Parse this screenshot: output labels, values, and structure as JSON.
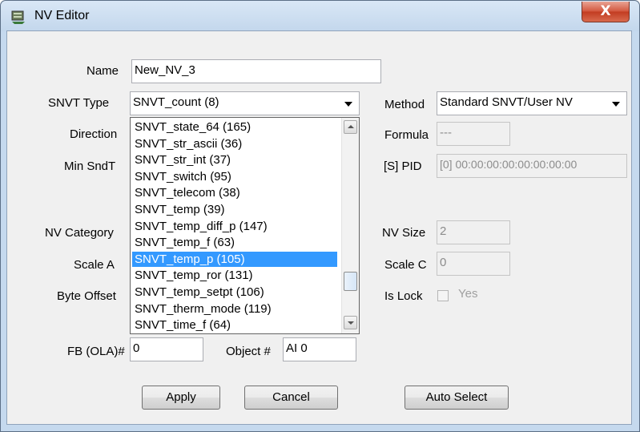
{
  "window": {
    "title": "NV Editor",
    "close_label": "X"
  },
  "labels": {
    "name": "Name",
    "snvt_type": "SNVT Type",
    "direction": "Direction",
    "min_sndt": "Min SndT",
    "nv_category": "NV Category",
    "scale_a": "Scale A",
    "byte_offset": "Byte Offset",
    "fb_ola": "FB (OLA)#",
    "object": "Object #",
    "method": "Method",
    "formula": "Formula",
    "s_pid": "[S] PID",
    "nv_size": "NV Size",
    "scale_c": "Scale C",
    "is_lock": "Is Lock",
    "yes": "Yes"
  },
  "fields": {
    "name_value": "New_NV_3",
    "snvt_type_value": "SNVT_count (8)",
    "method_value": "Standard SNVT/User NV",
    "formula_value": "---",
    "pid_value": "[0] 00:00:00:00:00:00:00:00",
    "nv_size_value": "2",
    "scale_c_value": "0",
    "fb_ola_value": "0",
    "object_value": "AI 0"
  },
  "dropdown": {
    "items": [
      "SNVT_state_64 (165)",
      "SNVT_str_ascii (36)",
      "SNVT_str_int (37)",
      "SNVT_switch (95)",
      "SNVT_telecom (38)",
      "SNVT_temp (39)",
      "SNVT_temp_diff_p (147)",
      "SNVT_temp_f (63)",
      "SNVT_temp_p (105)",
      "SNVT_temp_ror (131)",
      "SNVT_temp_setpt (106)",
      "SNVT_therm_mode (119)",
      "SNVT_time_f (64)"
    ],
    "selected_index": 8
  },
  "buttons": {
    "apply": "Apply",
    "cancel": "Cancel",
    "auto_select": "Auto Select"
  },
  "colors": {
    "selection": "#3399ff",
    "close_button": "#c9452b",
    "titlebar": "#c9dcf0"
  }
}
